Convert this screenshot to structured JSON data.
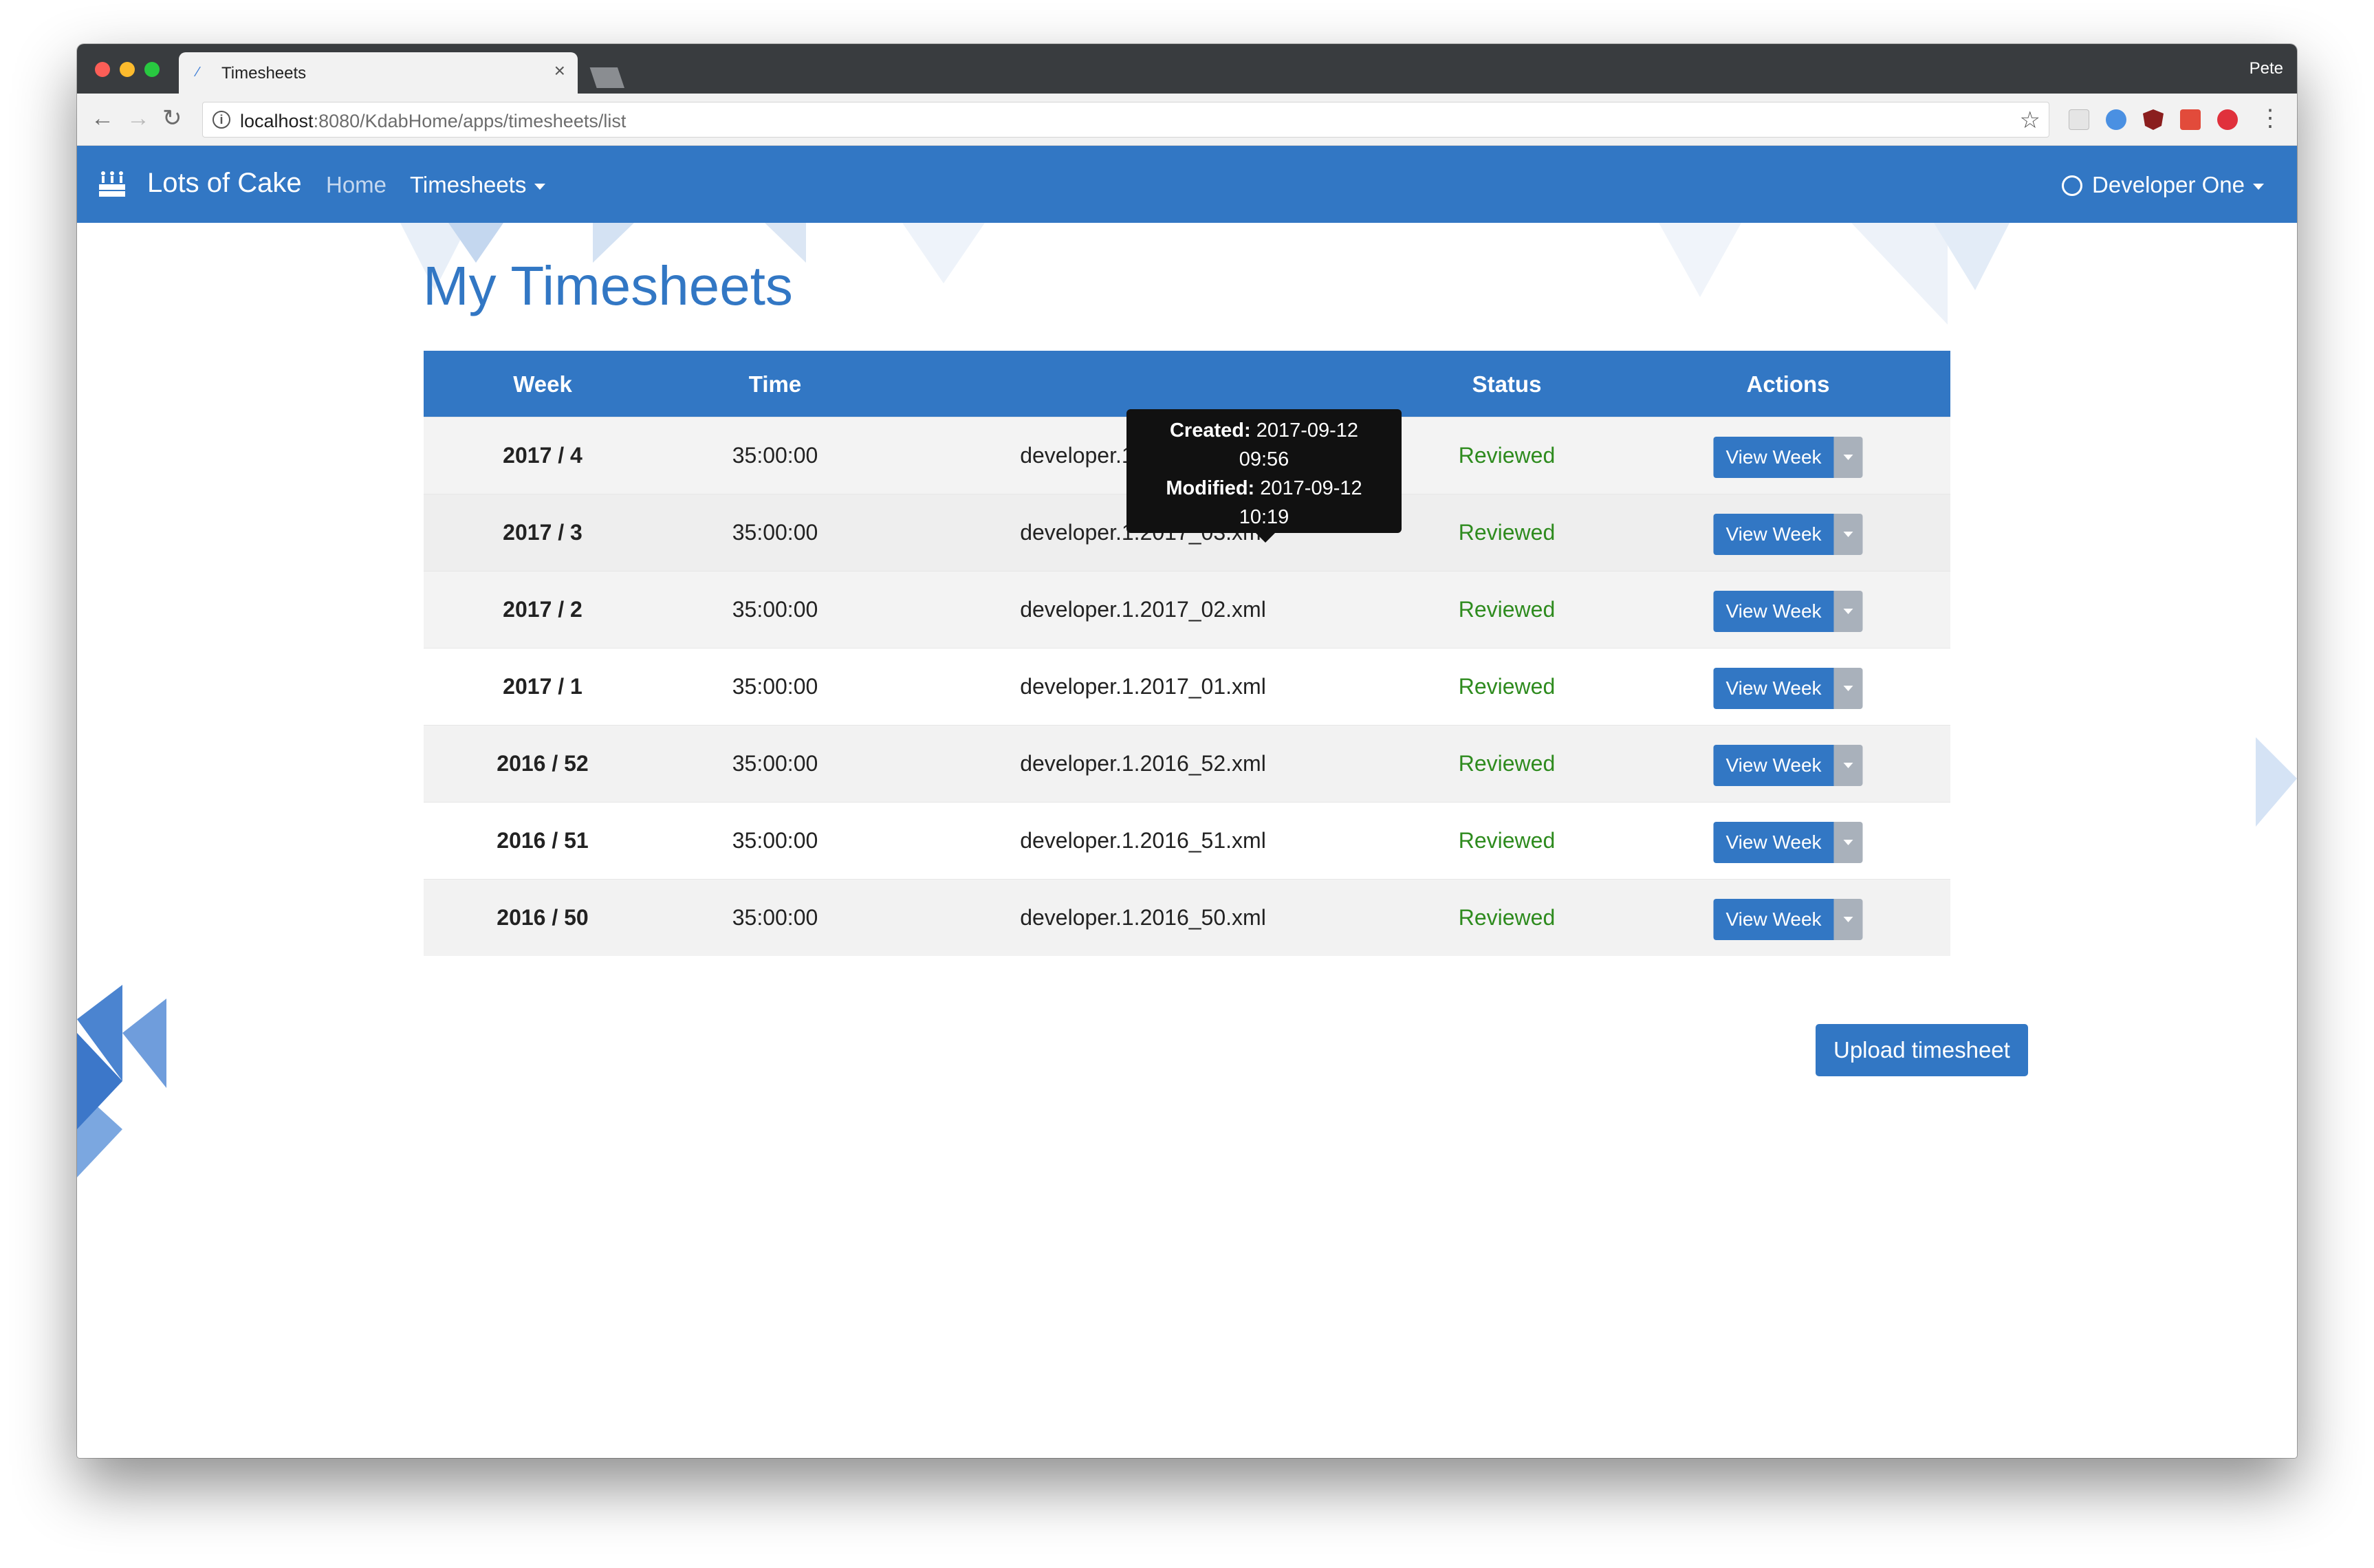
{
  "browser": {
    "tab_title": "Timesheets",
    "tab_close": "×",
    "profile_name": "Pete",
    "url_host": "localhost",
    "url_rest": ":8080/KdabHome/apps/timesheets/list",
    "icons": [
      "back-icon",
      "forward-icon",
      "reload-icon",
      "info-icon",
      "star-icon",
      "menu-icon"
    ]
  },
  "navbar": {
    "brand": "Lots of Cake",
    "home": "Home",
    "timesheets": "Timesheets",
    "user": "Developer One",
    "color": "#3277c4"
  },
  "page": {
    "title": "My Timesheets"
  },
  "table": {
    "headers": [
      "Week",
      "Time",
      "",
      "Status",
      "Actions"
    ],
    "rows": [
      {
        "week": "2017 / 4",
        "time": "35:00:00",
        "file": "developer.1.2017_04.xml",
        "status": "Reviewed",
        "action": "View Week"
      },
      {
        "week": "2017 / 3",
        "time": "35:00:00",
        "file": "developer.1.2017_03.xml",
        "status": "Reviewed",
        "action": "View Week"
      },
      {
        "week": "2017 / 2",
        "time": "35:00:00",
        "file": "developer.1.2017_02.xml",
        "status": "Reviewed",
        "action": "View Week"
      },
      {
        "week": "2017 / 1",
        "time": "35:00:00",
        "file": "developer.1.2017_01.xml",
        "status": "Reviewed",
        "action": "View Week"
      },
      {
        "week": "2016 / 52",
        "time": "35:00:00",
        "file": "developer.1.2016_52.xml",
        "status": "Reviewed",
        "action": "View Week"
      },
      {
        "week": "2016 / 51",
        "time": "35:00:00",
        "file": "developer.1.2016_51.xml",
        "status": "Reviewed",
        "action": "View Week"
      },
      {
        "week": "2016 / 50",
        "time": "35:00:00",
        "file": "developer.1.2016_50.xml",
        "status": "Reviewed",
        "action": "View Week"
      }
    ]
  },
  "tooltip": {
    "created_label": "Created:",
    "created_date": "2017-09-12",
    "created_time": "09:56",
    "modified_label": "Modified:",
    "modified_date": "2017-09-12",
    "modified_time": "10:19"
  },
  "upload_button": "Upload timesheet",
  "colors": {
    "accent": "#3277c4",
    "status_reviewed": "#2e8b1e",
    "tooltip_bg": "#111111"
  }
}
